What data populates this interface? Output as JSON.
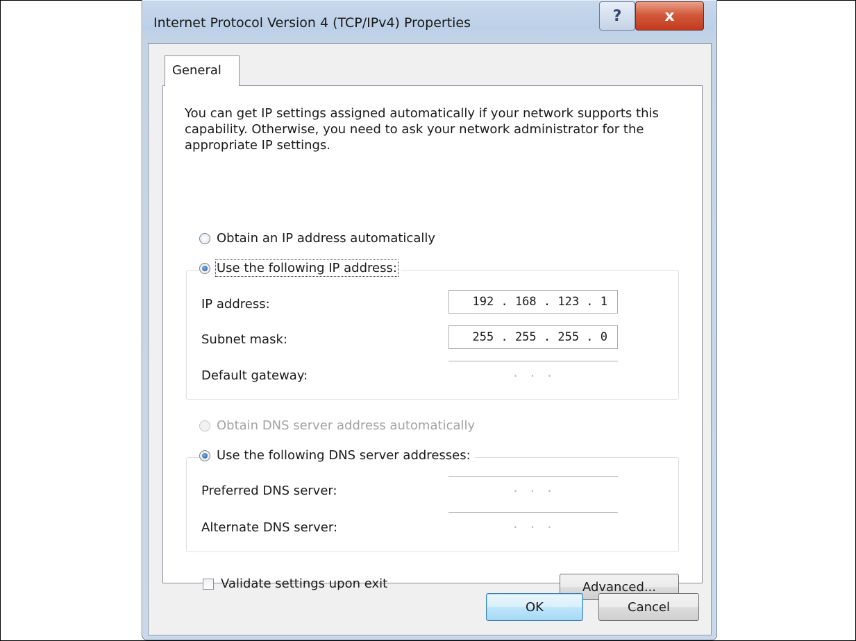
{
  "window": {
    "title": "Internet Protocol Version 4 (TCP/IPv4) Properties",
    "help_label": "?",
    "close_label": "x"
  },
  "tabs": [
    {
      "label": "General",
      "selected": true
    }
  ],
  "intro_text": "You can get IP settings assigned automatically if your network supports this capability. Otherwise, you need to ask your network administrator for the appropriate IP settings.",
  "ip_section": {
    "auto_label": "Obtain an IP address automatically",
    "auto_checked": false,
    "manual_label": "Use the following IP address:",
    "manual_checked": true,
    "fields": {
      "ip_address": {
        "label": "IP address:",
        "value": "192 . 168 . 123 .  1"
      },
      "subnet_mask": {
        "label": "Subnet mask:",
        "value": "255 . 255 . 255 .  0"
      },
      "default_gateway": {
        "label": "Default gateway:",
        "value": ".     .     ."
      }
    }
  },
  "dns_section": {
    "auto_label": "Obtain DNS server address automatically",
    "auto_checked": false,
    "auto_enabled": false,
    "manual_label": "Use the following DNS server addresses:",
    "manual_checked": true,
    "fields": {
      "preferred": {
        "label": "Preferred DNS server:",
        "value": ".     .     ."
      },
      "alternate": {
        "label": "Alternate DNS server:",
        "value": ".     .     ."
      }
    }
  },
  "validate": {
    "label": "Validate settings upon exit",
    "checked": false
  },
  "buttons": {
    "advanced": "Advanced...",
    "ok": "OK",
    "cancel": "Cancel"
  }
}
